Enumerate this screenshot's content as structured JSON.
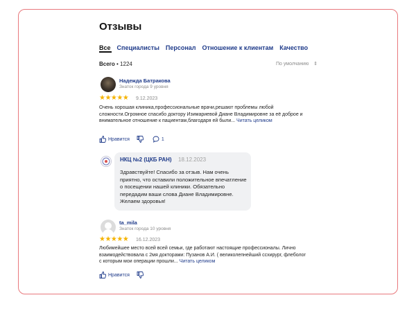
{
  "page": {
    "title": "Отзывы",
    "tabs": [
      "Все",
      "Специалисты",
      "Персонал",
      "Отношение к клиентам",
      "Качество"
    ],
    "total_label": "Всего",
    "total_count": "• 1224",
    "sort_label": "По умолчанию",
    "sort_icon": "sort-arrows-icon"
  },
  "reviews": [
    {
      "author": "Надежда Батракова",
      "level": "Знаток города 9 уровня",
      "rating": 5,
      "stars": "★★★★★",
      "date": "9.12.2023",
      "text": "Очень хорошая клиника,профессиональные врачи,решают проблемы любой сложности.Огромное спасибо доктору Изимариевой Диане Владимировне за её доброе и внимательное отношение к пациентам,благодаря ей были...",
      "read_more": "Читать целиком",
      "like_label": "Нравится",
      "comments_count": "1"
    },
    {
      "author": "ta_mila",
      "level": "Знаток города 10 уровня",
      "rating": 5,
      "stars": "★★★★★",
      "date": "16.12.2023",
      "text": "Любимейшее место всей всей семьи, где работают настоящие профессионалы. Лично взаимодействовала с 2мя докторами: Пузанов А.И. ( великолепнейший ссхирург, флеболог с которым мои операции прошли...",
      "read_more": "Читать целиком",
      "like_label": "Нравится"
    }
  ],
  "reply": {
    "org_name": "НКЦ №2 (ЦКБ РАН)",
    "date": "18.12.2023",
    "text": "Здравствуйте! Спасибо за отзыв. Нам очень приятно, что оставили положительное впечатление о посещении нашей клиники. Обязательно передадим ваши слова Диане Владимировне. Желаем здоровья!"
  },
  "colors": {
    "frame_border": "#e8787c",
    "link": "#1f3b8a",
    "star": "#f5b301",
    "reply_bg": "#f0f1f3"
  }
}
